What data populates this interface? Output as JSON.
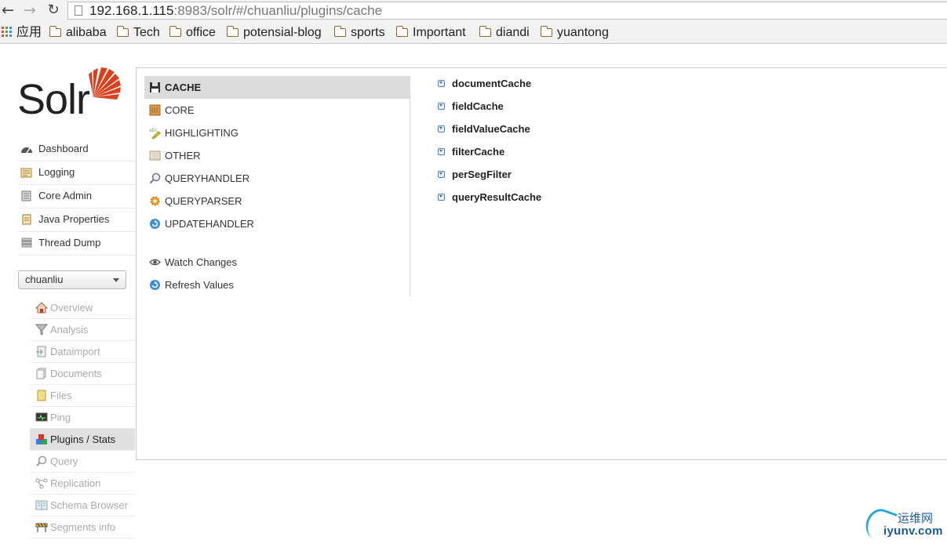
{
  "browser": {
    "url_host": "192.168.1.115",
    "url_rest": ":8983/solr/#/chuanliu/plugins/cache",
    "bookmarks": [
      "应用",
      "alibaba",
      "Tech",
      "office",
      "potensial-blog",
      "sports",
      "Important",
      "diandi",
      "yuantong"
    ]
  },
  "logo": {
    "text": "Solr"
  },
  "main_nav": [
    {
      "label": "Dashboard",
      "icon": "dashboard-icon"
    },
    {
      "label": "Logging",
      "icon": "logging-icon"
    },
    {
      "label": "Core Admin",
      "icon": "core-admin-icon"
    },
    {
      "label": "Java Properties",
      "icon": "java-properties-icon"
    },
    {
      "label": "Thread Dump",
      "icon": "thread-dump-icon"
    }
  ],
  "core_selector": {
    "value": "chuanliu"
  },
  "core_nav": [
    {
      "label": "Overview",
      "icon": "home-icon"
    },
    {
      "label": "Analysis",
      "icon": "funnel-icon"
    },
    {
      "label": "Dataimport",
      "icon": "dataimport-icon"
    },
    {
      "label": "Documents",
      "icon": "documents-icon"
    },
    {
      "label": "Files",
      "icon": "files-icon"
    },
    {
      "label": "Ping",
      "icon": "ping-icon"
    },
    {
      "label": "Plugins / Stats",
      "icon": "plugins-icon",
      "active": true
    },
    {
      "label": "Query",
      "icon": "query-icon"
    },
    {
      "label": "Replication",
      "icon": "replication-icon"
    },
    {
      "label": "Schema Browser",
      "icon": "schema-browser-icon"
    },
    {
      "label": "Segments info",
      "icon": "segments-icon"
    }
  ],
  "categories": [
    {
      "label": "CACHE",
      "icon": "floppy-disk-icon",
      "active": true
    },
    {
      "label": "CORE",
      "icon": "core-icon"
    },
    {
      "label": "HIGHLIGHTING",
      "icon": "highlighter-icon"
    },
    {
      "label": "OTHER",
      "icon": "other-icon"
    },
    {
      "label": "QUERYHANDLER",
      "icon": "magnifier-icon"
    },
    {
      "label": "QUERYPARSER",
      "icon": "gear-icon"
    },
    {
      "label": "UPDATEHANDLER",
      "icon": "refresh-icon"
    }
  ],
  "actions": [
    {
      "label": "Watch Changes",
      "icon": "eye-icon"
    },
    {
      "label": "Refresh Values",
      "icon": "refresh-icon"
    }
  ],
  "plugins": [
    "documentCache",
    "fieldCache",
    "fieldValueCache",
    "filterCache",
    "perSegFilter",
    "queryResultCache"
  ],
  "watermark": {
    "cn": "运维网",
    "en": "iyunv.com"
  },
  "colors": {
    "solr_orange": "#d9411e",
    "active_bg": "#dcdcdc",
    "link_blue": "#4a7fc1"
  }
}
